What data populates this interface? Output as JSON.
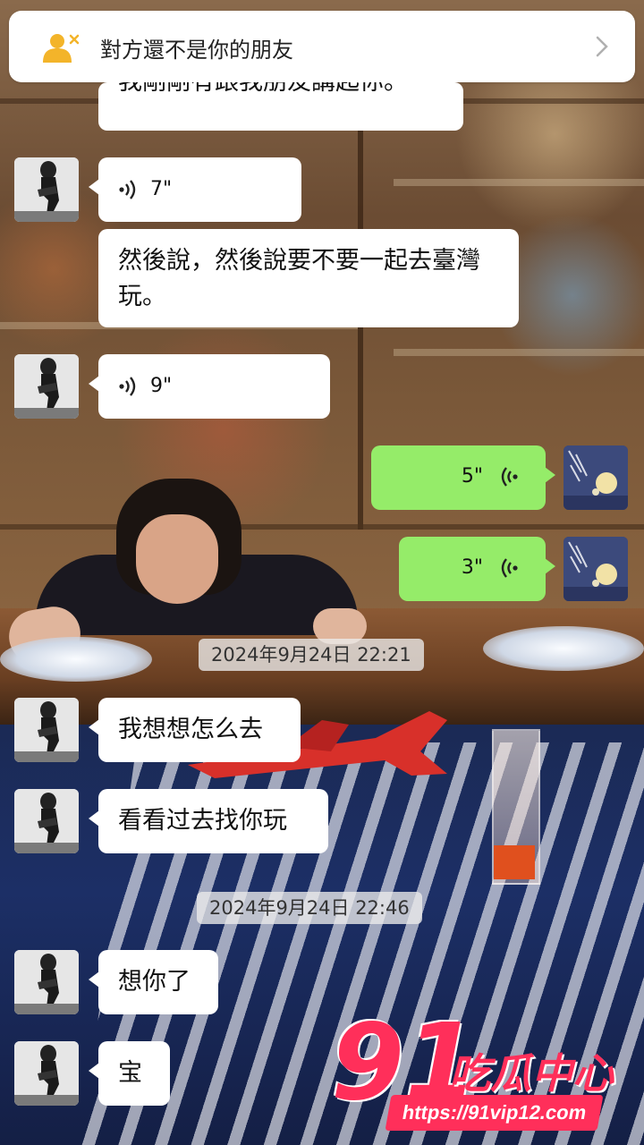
{
  "notice": {
    "icon": "person-not-friend-icon",
    "text": "對方還不是你的朋友",
    "chevron": "chevron-right-icon"
  },
  "messages": {
    "m0": "我剛剛有跟我朋友講起你。",
    "m1_voice": "7\"",
    "m2": "然後說，然後說要不要一起去臺灣玩。",
    "m3_voice": "9\"",
    "m4_voice": "5\"",
    "m5_voice": "3\"",
    "m6": "我想想怎么去",
    "m7": "看看过去找你玩",
    "m8": "想你了",
    "m9": "宝"
  },
  "timestamps": {
    "t1": "2024年9月24日 22:21",
    "t2": "2024年9月24日 22:46"
  },
  "watermark": {
    "brand_num": "91",
    "brand_cn": "吃瓜中心",
    "url": "https://91vip12.com"
  },
  "colors": {
    "outgoing_bubble": "#95ec69",
    "incoming_bubble": "#ffffff",
    "notice_icon": "#f3b42a",
    "watermark": "#ff2f5a"
  }
}
